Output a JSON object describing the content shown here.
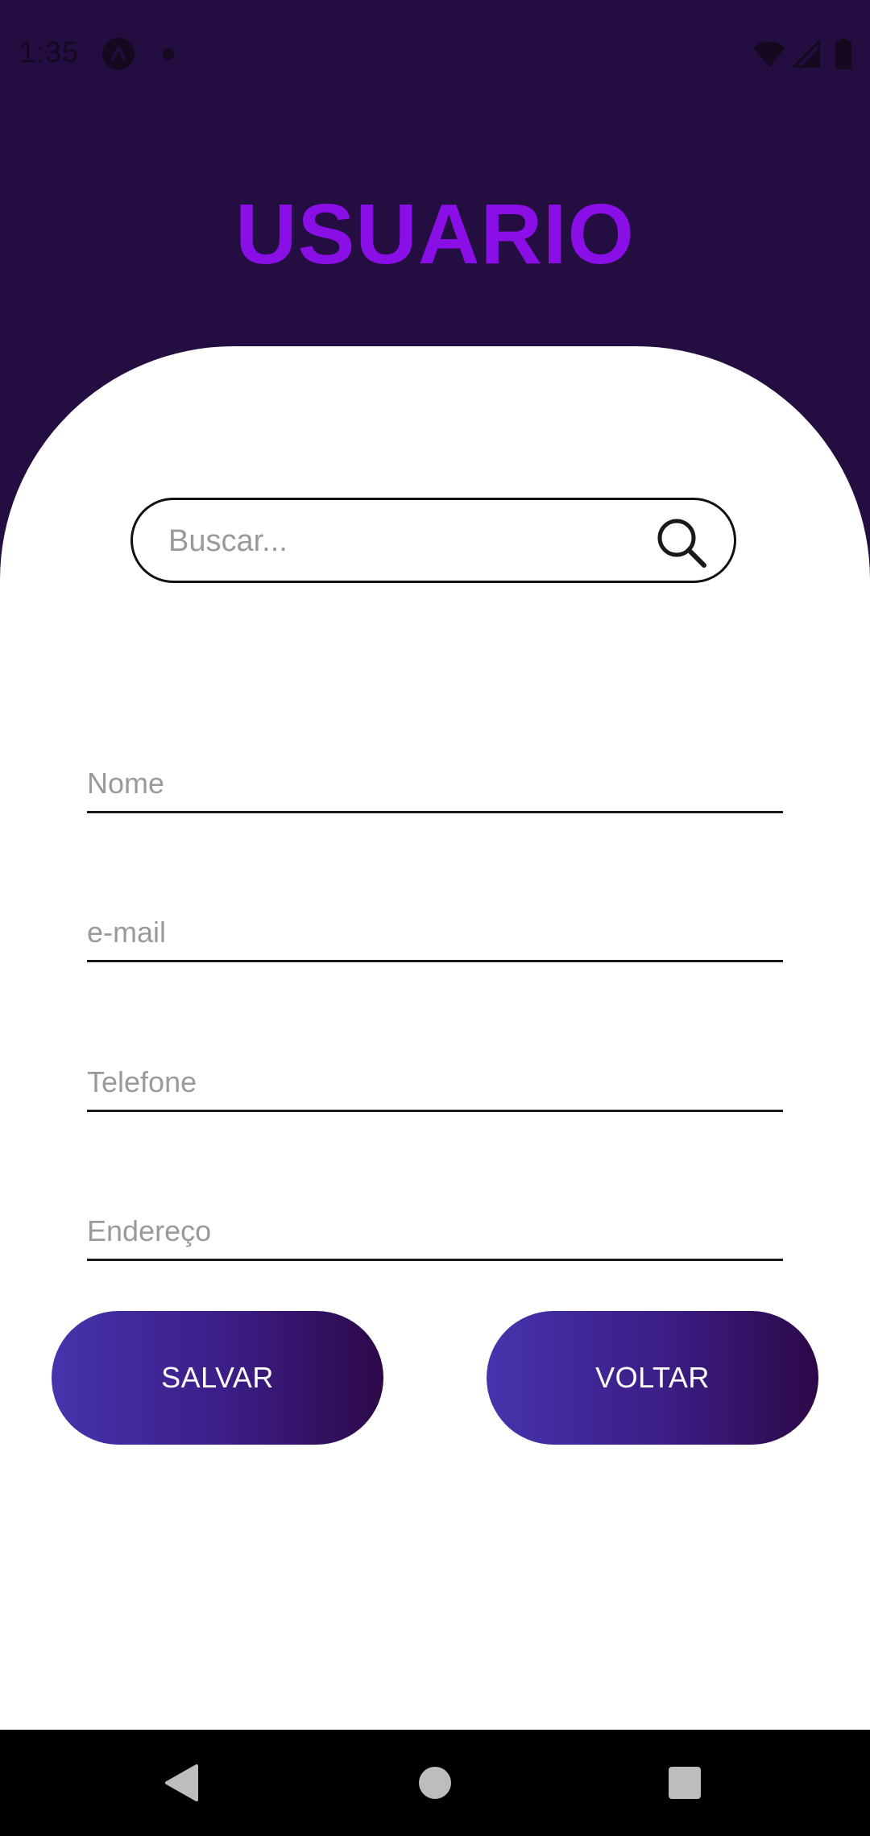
{
  "status_bar": {
    "time": "1:35",
    "app_icon": "app-notification-icon",
    "indicators": [
      "wifi-icon",
      "cellular-signal-icon",
      "battery-icon"
    ]
  },
  "header": {
    "title": "USUARIO"
  },
  "search": {
    "placeholder": "Buscar...",
    "value": "",
    "icon": "search-icon"
  },
  "form": {
    "name": {
      "placeholder": "Nome",
      "value": ""
    },
    "email": {
      "placeholder": "e-mail",
      "value": ""
    },
    "phone": {
      "placeholder": "Telefone",
      "value": ""
    },
    "address": {
      "placeholder": "Endereço",
      "value": ""
    }
  },
  "actions": {
    "save_label": "SALVAR",
    "back_label": "VOLTAR"
  },
  "navigation_bar": {
    "buttons": [
      "back-triangle-icon",
      "home-circle-icon",
      "recents-square-icon"
    ]
  },
  "colors": {
    "header_background": "#240d41",
    "title": "#8a0ee6",
    "button_gradient_start": "#4733ad",
    "button_gradient_end": "#2d0848",
    "button_text": "#ffffff"
  }
}
